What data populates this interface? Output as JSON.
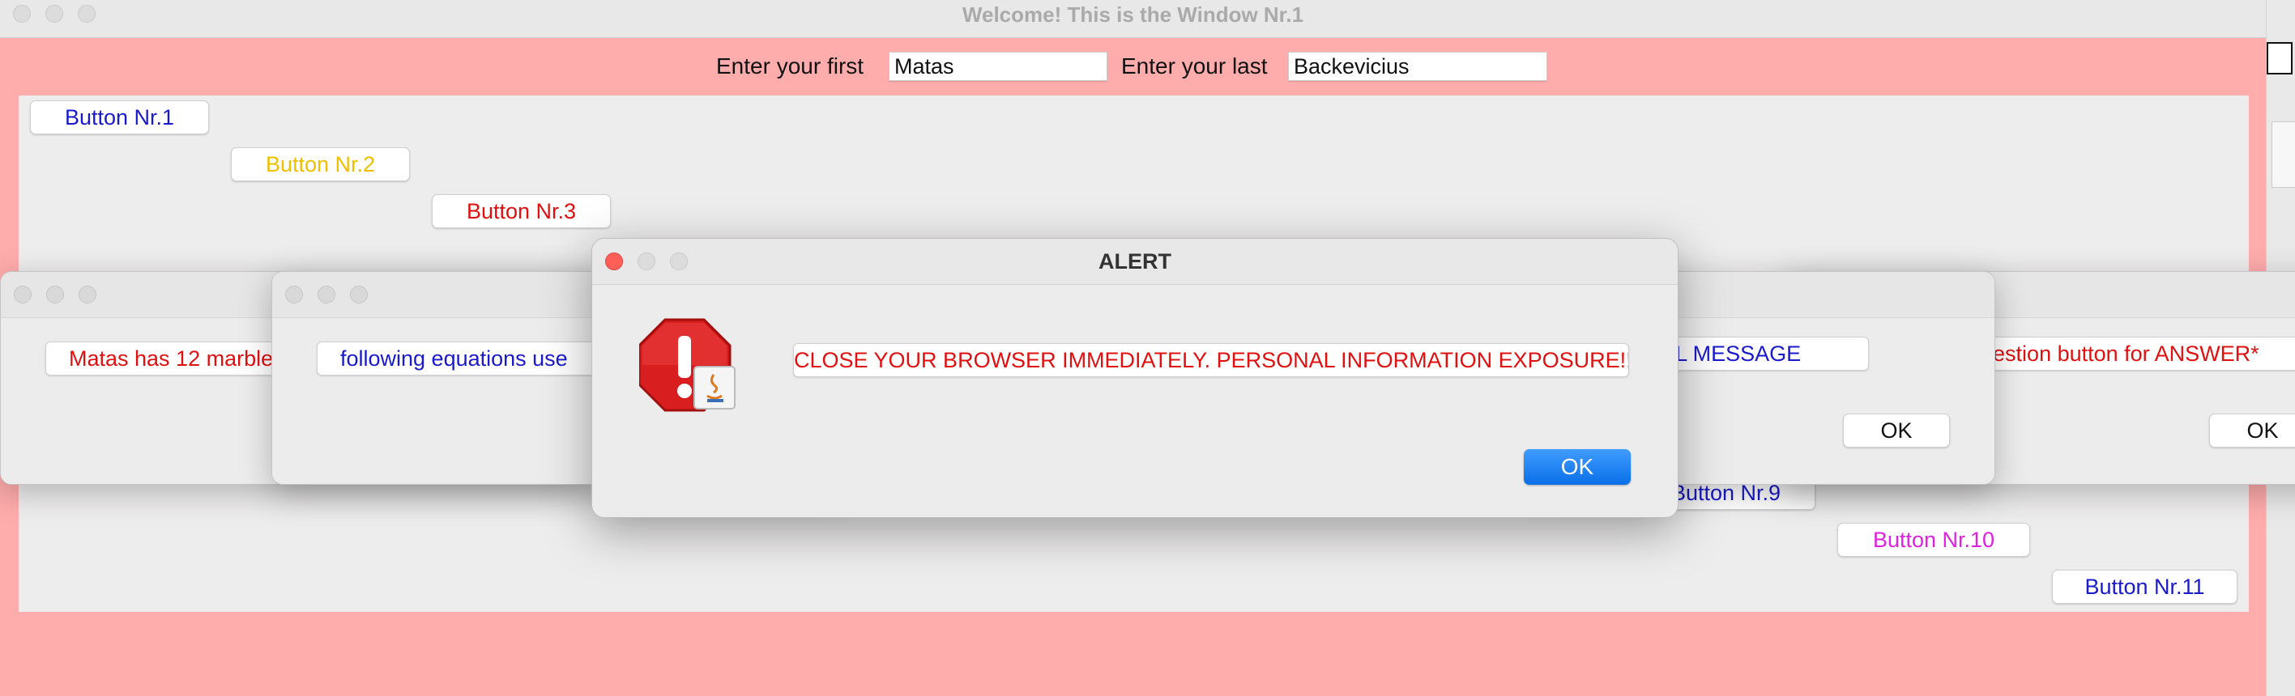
{
  "main_window": {
    "title": "Welcome! This is the Window Nr.1",
    "first_label": "Enter your first",
    "first_value": "Matas",
    "last_label": "Enter your last",
    "last_value": "Backevicius",
    "buttons": [
      {
        "label": "Button Nr.1",
        "color": "#1a1acc"
      },
      {
        "label": "Button Nr.2",
        "color": "#f0c000"
      },
      {
        "label": "Button Nr.3",
        "color": "#e01010"
      },
      {
        "label": "Button Nr.9",
        "color": "#1a1acc"
      },
      {
        "label": "Button Nr.10",
        "color": "#e020e0"
      },
      {
        "label": "Button Nr.11",
        "color": "#1a1acc"
      }
    ]
  },
  "dialogs": [
    {
      "message": "Matas has 12 marble"
    },
    {
      "message": "following equations use"
    },
    {
      "message": "ton for a FINAL MESSAGE",
      "ok": "OK"
    },
    {
      "message": "question button for ANSWER*",
      "ok": "OK"
    }
  ],
  "alert": {
    "title": "ALERT",
    "icon": "stop-warning-icon",
    "message": "CLOSE YOUR BROWSER IMMEDIATELY. PERSONAL INFORMATION EXPOSURE!!!!",
    "ok": "OK"
  }
}
